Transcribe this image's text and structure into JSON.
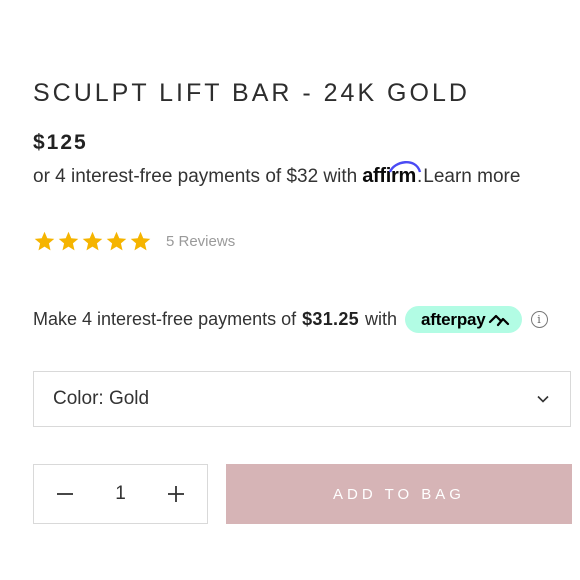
{
  "product": {
    "title": "SCULPT LIFT BAR - 24K GOLD",
    "price": "$125"
  },
  "affirm": {
    "prefix": "or 4 interest-free payments of $32 with",
    "logo_text": "affirm",
    "suffix": ".",
    "learn_more": "Learn more"
  },
  "rating": {
    "stars": 5,
    "max_stars": 5,
    "star_color": "#f5b400",
    "reviews_label": "5 Reviews"
  },
  "afterpay": {
    "prefix": "Make 4 interest-free payments of",
    "amount": "$31.25",
    "with": "with",
    "logo_text": "afterpay",
    "badge_color": "#b2fce4",
    "info_icon": "i"
  },
  "color_select": {
    "label": "Color: Gold",
    "icon": "chevron-down-icon"
  },
  "quantity": {
    "value": "1",
    "decrement_icon": "minus-icon",
    "increment_icon": "plus-icon"
  },
  "add_to_bag": {
    "label": "ADD TO BAG",
    "color": "#d6b4b6"
  }
}
